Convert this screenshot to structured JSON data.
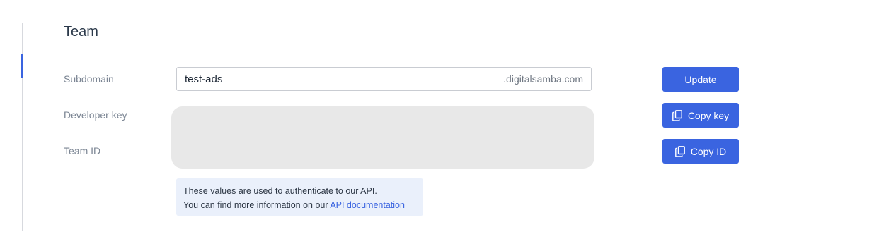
{
  "section": {
    "title": "Team"
  },
  "labels": {
    "subdomain": "Subdomain",
    "developer_key": "Developer key",
    "team_id": "Team ID"
  },
  "subdomain_input": {
    "value": "test-ads",
    "suffix": ".digitalsamba.com"
  },
  "buttons": {
    "update": "Update",
    "copy_key": "Copy key",
    "copy_id": "Copy ID"
  },
  "info": {
    "line1": "These values are used to authenticate to our API.",
    "line2_prefix": "You can find more information on our ",
    "link_text": "API documentation"
  },
  "icons": {
    "copy": "copy-icon"
  },
  "colors": {
    "accent": "#3a64e0",
    "info_bg": "#eaf0fb",
    "masked_bg": "#e8e8e8"
  }
}
